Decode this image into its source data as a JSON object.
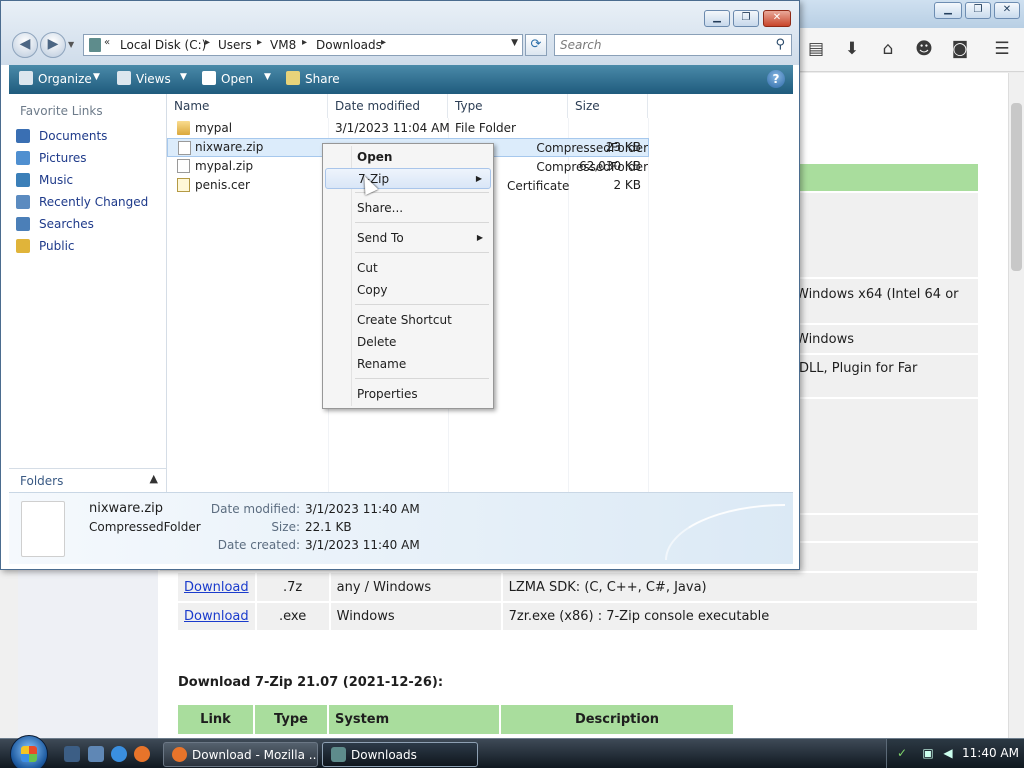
{
  "firefox": {
    "toolbar_icons": [
      "reader-icon",
      "download-icon",
      "home-icon",
      "smiley-icon",
      "pocket-icon",
      "menu-icon"
    ],
    "peek_lines": [
      "Windows x64 (Intel 64 or",
      "Windows",
      "DLL, Plugin for Far"
    ],
    "download_rows": [
      {
        "link": "Download",
        "ext": ".7z",
        "platform": "any / Windows",
        "description": "LZMA SDK: (C, C++, C#, Java)"
      },
      {
        "link": "Download",
        "ext": ".exe",
        "platform": "Windows",
        "description": "7zr.exe (x86) : 7-Zip console executable"
      }
    ],
    "section_heading": "Download 7-Zip 21.07 (2021-12-26):",
    "table_headers": [
      "Link",
      "Type",
      "System",
      "Description"
    ]
  },
  "explorer": {
    "address": {
      "overflow": "«",
      "crumbs": [
        "Local Disk (C:)",
        "Users",
        "VM8",
        "Downloads"
      ]
    },
    "search": {
      "placeholder": "Search"
    },
    "commands": {
      "organize": "Organize",
      "views": "Views",
      "open": "Open",
      "share": "Share"
    },
    "favorites": {
      "title": "Favorite Links",
      "items": [
        {
          "label": "Documents",
          "color": "#3a6fb3"
        },
        {
          "label": "Pictures",
          "color": "#4f8fd0"
        },
        {
          "label": "Music",
          "color": "#3b7fb8"
        },
        {
          "label": "Recently Changed",
          "color": "#5b8bc0"
        },
        {
          "label": "Searches",
          "color": "#4b7fb8"
        },
        {
          "label": "Public",
          "color": "#e0b43a"
        }
      ],
      "folders_label": "Folders"
    },
    "columns": [
      "Name",
      "Date modified",
      "Type",
      "Size"
    ],
    "files": [
      {
        "name": "mypal",
        "date": "3/1/2023 11:04 AM",
        "type": "File Folder",
        "size": "",
        "icon": "folder"
      },
      {
        "name": "nixware.zip",
        "date": "3/1/2023 11:40 AM",
        "type": "CompressedFolder",
        "size": "23 KB",
        "icon": "zip"
      },
      {
        "name": "mypal.zip",
        "date": "",
        "type": "CompressedFolder",
        "size": "62,030 KB",
        "icon": "zip"
      },
      {
        "name": "penis.cer",
        "date": "",
        "type": "Security Certificate",
        "size": "2 KB",
        "icon": "cert"
      }
    ],
    "visible_types": [
      "CompressedFolder",
      "CompressedFolder",
      "Certificate"
    ],
    "details": {
      "name": "nixware.zip",
      "kind": "CompressedFolder",
      "modified_label": "Date modified:",
      "modified": "3/1/2023 11:40 AM",
      "size_label": "Size:",
      "size": "22.1 KB",
      "created_label": "Date created:",
      "created": "3/1/2023 11:40 AM"
    }
  },
  "context_menu": {
    "items": {
      "open": "Open",
      "sevenzip": "7-Zip",
      "share": "Share...",
      "sendto": "Send To",
      "cut": "Cut",
      "copy": "Copy",
      "shortcut": "Create Shortcut",
      "delete": "Delete",
      "rename": "Rename",
      "properties": "Properties"
    }
  },
  "taskbar": {
    "tasks": [
      {
        "label": "Download - Mozilla ...",
        "active": false
      },
      {
        "label": "Downloads",
        "active": true
      }
    ],
    "clock": "11:40 AM"
  }
}
